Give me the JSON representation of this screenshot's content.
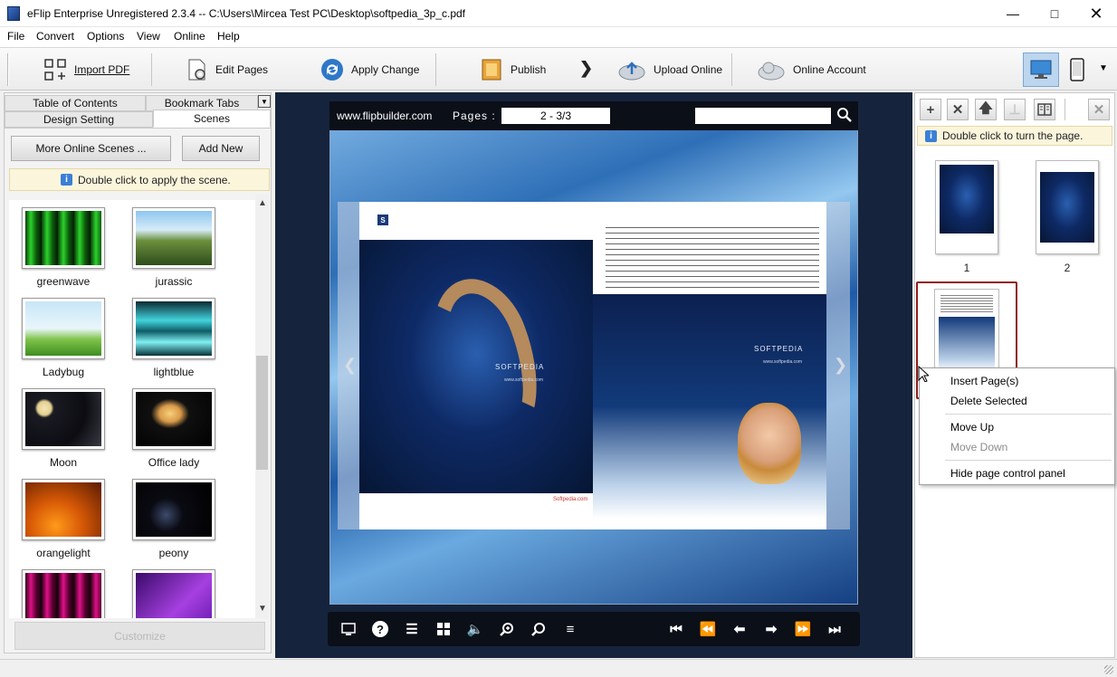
{
  "window": {
    "title": "eFlip Enterprise Unregistered 2.3.4  -- C:\\Users\\Mircea Test PC\\Desktop\\softpedia_3p_c.pdf"
  },
  "menu": [
    "File",
    "Convert",
    "Options",
    "View",
    "Online",
    "Help"
  ],
  "toolbar": {
    "import_pdf": "Import PDF",
    "edit_pages": "Edit Pages",
    "apply_change": "Apply Change",
    "publish": "Publish",
    "upload_online": "Upload Online",
    "online_account": "Online Account"
  },
  "left": {
    "tabs": [
      "Table of Contents",
      "Bookmark Tabs",
      "Design Setting",
      "Scenes"
    ],
    "more_scenes": "More Online Scenes ...",
    "add_new": "Add New",
    "hint": "Double click to apply the scene.",
    "scenes": [
      {
        "label": "greenwave"
      },
      {
        "label": "jurassic"
      },
      {
        "label": "Ladybug"
      },
      {
        "label": "lightblue"
      },
      {
        "label": "Moon"
      },
      {
        "label": "Office lady"
      },
      {
        "label": "orangelight"
      },
      {
        "label": "peony"
      }
    ],
    "customize": "Customize"
  },
  "viewer": {
    "site": "www.flipbuilder.com",
    "pages_label": "Pages :",
    "pages_value": "2 - 3/3",
    "brand": "SOFTPEDIA",
    "brand_url": "www.softpedia.com",
    "logo_letter": "S",
    "footer_url": "Softpedia.com"
  },
  "right": {
    "hint": "Double click to turn the page.",
    "pages": [
      {
        "label": "1"
      },
      {
        "label": "2"
      }
    ],
    "context_menu": [
      "Insert Page(s)",
      "Delete Selected",
      "Move Up",
      "Move Down",
      "Hide page control panel"
    ]
  }
}
